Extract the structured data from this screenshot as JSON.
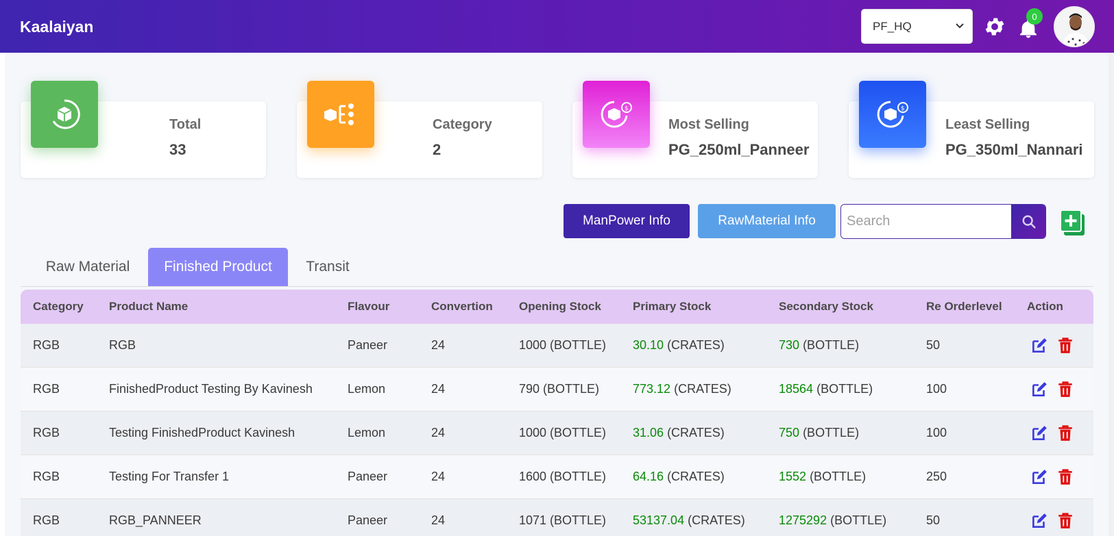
{
  "header": {
    "brand": "Kaalaiyan",
    "branch": "PF_HQ",
    "notification_count": "0"
  },
  "stats": [
    {
      "label": "Total",
      "value": "33",
      "color": "#5cb85c"
    },
    {
      "label": "Category",
      "value": "2",
      "color": "#ffa122"
    },
    {
      "label": "Most Selling",
      "value": "PG_250ml_Panneer",
      "color": "#e53be8"
    },
    {
      "label": "Least Selling",
      "value": "PG_350ml_Nannari",
      "color": "#1e5cf5"
    }
  ],
  "actions": {
    "manpower": "ManPower Info",
    "rawmaterial": "RawMaterial Info",
    "search_placeholder": "Search"
  },
  "tabs": [
    "Raw Material",
    "Finished Product",
    "Transit"
  ],
  "table": {
    "headers": [
      "Category",
      "Product Name",
      "Flavour",
      "Convertion",
      "Opening Stock",
      "Primary Stock",
      "Secondary Stock",
      "Re Orderlevel",
      "Action"
    ],
    "rows": [
      {
        "category": "RGB",
        "product": "RGB",
        "flavour": "Paneer",
        "convertion": "24",
        "opening": "1000 (BOTTLE)",
        "primary_val": "30.10",
        "primary_unit": "(CRATES)",
        "secondary_val": "730",
        "secondary_unit": "(BOTTLE)",
        "reorder": "50"
      },
      {
        "category": "RGB",
        "product": "FinishedProduct Testing By Kavinesh",
        "flavour": "Lemon",
        "convertion": "24",
        "opening": "790 (BOTTLE)",
        "primary_val": "773.12",
        "primary_unit": "(CRATES)",
        "secondary_val": "18564",
        "secondary_unit": "(BOTTLE)",
        "reorder": "100"
      },
      {
        "category": "RGB",
        "product": "Testing FinishedProduct Kavinesh",
        "flavour": "Lemon",
        "convertion": "24",
        "opening": "1000 (BOTTLE)",
        "primary_val": "31.06",
        "primary_unit": "(CRATES)",
        "secondary_val": "750",
        "secondary_unit": "(BOTTLE)",
        "reorder": "100"
      },
      {
        "category": "RGB",
        "product": "Testing For Transfer 1",
        "flavour": "Paneer",
        "convertion": "24",
        "opening": "1600 (BOTTLE)",
        "primary_val": "64.16",
        "primary_unit": "(CRATES)",
        "secondary_val": "1552",
        "secondary_unit": "(BOTTLE)",
        "reorder": "250"
      },
      {
        "category": "RGB",
        "product": "RGB_PANNEER",
        "flavour": "Paneer",
        "convertion": "24",
        "opening": "1071 (BOTTLE)",
        "primary_val": "53137.04",
        "primary_unit": "(CRATES)",
        "secondary_val": "1275292",
        "secondary_unit": "(BOTTLE)",
        "reorder": "50"
      }
    ]
  }
}
